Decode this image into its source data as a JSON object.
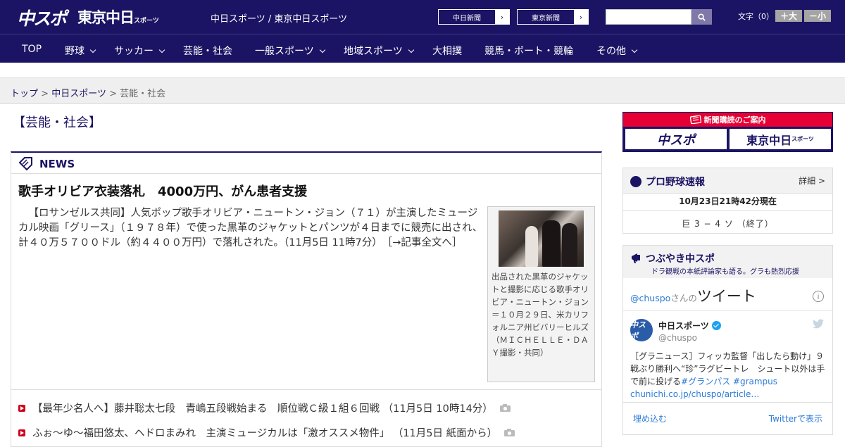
{
  "header": {
    "logo_chuspo": "中スポ",
    "logo_tokyo": "東京中日",
    "logo_tokyo_small": "スポーツ",
    "site_names": "中日スポーツ / 東京中日スポーツ",
    "ext_links": [
      {
        "label": "中日新聞",
        "arrow": "›"
      },
      {
        "label": "東京新聞",
        "arrow": "›"
      }
    ],
    "search_placeholder": "",
    "font_label": "文字（0）",
    "font_bigger": "＋大",
    "font_smaller": "－小"
  },
  "nav": {
    "items": [
      {
        "label": "TOP"
      },
      {
        "label": "野球"
      },
      {
        "label": "サッカー"
      },
      {
        "label": "芸能・社会"
      },
      {
        "label": "一般スポーツ"
      },
      {
        "label": "地域スポーツ"
      },
      {
        "label": "大相撲"
      },
      {
        "label": "競馬・ボート・競輪"
      },
      {
        "label": "その他"
      }
    ]
  },
  "breadcrumb": {
    "top": "トップ",
    "sep": ">",
    "chunichi": "中日スポーツ",
    "current": "芸能・社会"
  },
  "main": {
    "section_title": "【芸能・社会】",
    "news_label": "NEWS",
    "headline": "歌手オリビア衣装落札　4000万円、がん患者支援",
    "lead": "【ロサンゼルス共同】人気ポップ歌手オリビア・ニュートン・ジョン（７１）が主演したミュージカル映画「グリース」（１９７８年）で使った黒革のジャケットとパンツが４日までに競売に出され、計４０万５７００ドル（約４４００万円）で落札された。（11月5日 11時7分）",
    "lead_link": "［→記事全文へ］",
    "caption": "出品された黒革のジャケットと撮影に応じる歌手オリビア・ニュートン・ジョン＝１０月２９日、米カリフォルニア州ビバリーヒルズ（ＭＩＣＨＥＬＬＥ・ＤＡＹ撮影・共同）",
    "list": [
      {
        "text": "【最年少名人へ】藤井聡太七段　青嶋五段戦始まる　順位戦Ｃ級１組６回戦 （11月5日 10時14分）",
        "camera": "camera-icon"
      },
      {
        "text": "ふぉ～ゆ～福田悠太、ヘドロまみれ　主演ミュージカルは「激オススメ物件」 （11月5日 紙面から）",
        "camera": "camera-icon"
      }
    ]
  },
  "sidebar": {
    "subscribe_ribbon": "新聞購読のご案内",
    "subscribe_chuspo": "中スポ",
    "subscribe_tokyo": "東京中日",
    "subscribe_tokyo_small": "スポーツ",
    "baseball": {
      "title": "プロ野球速報",
      "detail": "詳細 >",
      "time": "10月23日21時42分現在",
      "game": "巨 3 − 4 ソ （終了）"
    },
    "twitter": {
      "title": "つぶやき中スポ",
      "subtitle": "ドラ観戦の本紙評論家も語る。グラも熱烈応援",
      "account": "@chuspo",
      "account_suffix": "さんの",
      "tweets_word": "ツイート",
      "info": "i",
      "avatar_text": "中スポ",
      "name": "中日スポーツ",
      "handle": "@chuspo",
      "body_text": "［グラニュース］フィッカ監督「出したら動け」９戦ぶり勝利へ“珍”ラグビートレ　シュート以外は手で前に投げる",
      "hashtag1": "#グランパス",
      "hashtag2": "#grampus",
      "link": "chunichi.co.jp/chuspo/article…",
      "embed": "埋め込む",
      "view": "Twitterで表示"
    }
  },
  "colors": {
    "navy": "#1b1464",
    "red": "#e60033",
    "link_blue": "#2a7ad9",
    "bullet_red": "#d0021b"
  }
}
